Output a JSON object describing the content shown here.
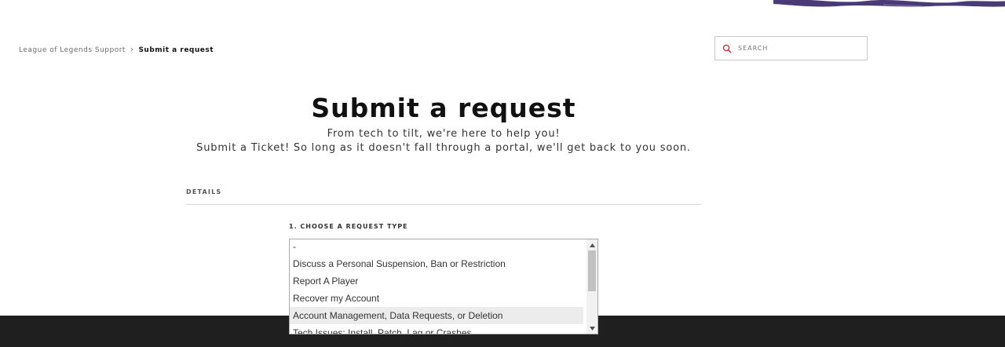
{
  "breadcrumb": {
    "root": "League of Legends Support",
    "separator": "›",
    "current": "Submit a request"
  },
  "search": {
    "placeholder": "SEARCH",
    "icon": "search-icon"
  },
  "header": {
    "title": "Submit a request",
    "subtitle_line1": "From tech to tilt, we're here to help you!",
    "subtitle_line2": "Submit a Ticket! So long as it doesn't fall through a portal, we'll get back to you soon."
  },
  "details": {
    "label": "DETAILS"
  },
  "request_type": {
    "label": "1. CHOOSE A REQUEST TYPE",
    "options": [
      "-",
      "Discuss a Personal Suspension, Ban or Restriction",
      "Report A Player",
      "Recover my Account",
      "Account Management, Data Requests, or Deletion",
      "Tech Issues: Install, Patch, Lag or Crashes"
    ],
    "highlighted": "Account Management, Data Requests, or Deletion"
  },
  "colors": {
    "accent": "#c8303a",
    "footer": "#1f1f1f",
    "brush": "#4b3a78"
  }
}
